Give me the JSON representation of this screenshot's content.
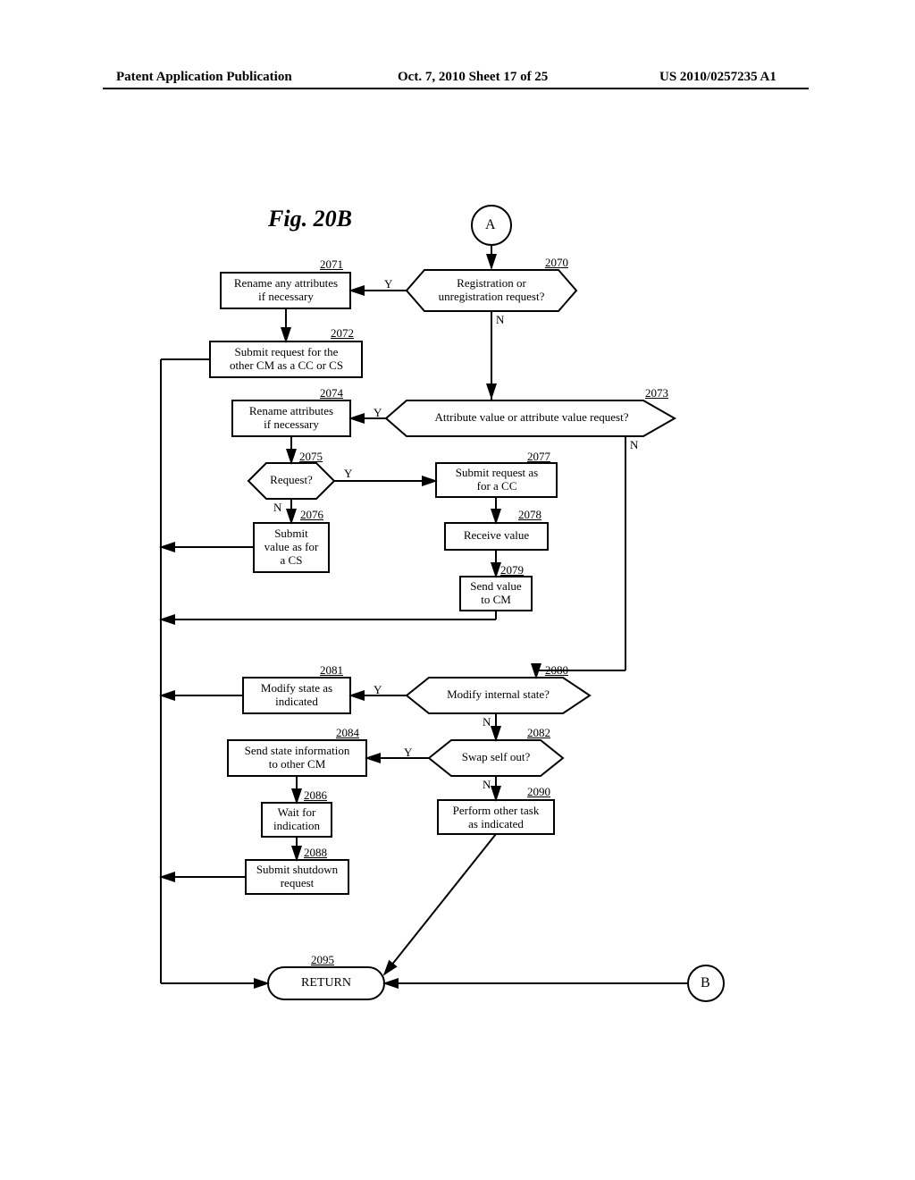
{
  "header": {
    "left": "Patent Application Publication",
    "center": "Oct. 7, 2010  Sheet 17 of 25",
    "right": "US 2010/0257235 A1"
  },
  "figure_title": "Fig. 20B",
  "connectors": {
    "A": "A",
    "B": "B"
  },
  "nodes": {
    "n2070": {
      "num": "2070",
      "text": "Registration or\nunregistration request?"
    },
    "n2071": {
      "num": "2071",
      "text": "Rename any attributes\nif necessary"
    },
    "n2072": {
      "num": "2072",
      "text": "Submit request for the\nother CM as a CC or CS"
    },
    "n2073": {
      "num": "2073",
      "text": "Attribute value or attribute value request?"
    },
    "n2074": {
      "num": "2074",
      "text": "Rename attributes\nif necessary"
    },
    "n2075": {
      "num": "2075",
      "text": "Request?"
    },
    "n2076": {
      "num": "2076",
      "text": "Submit\nvalue as for\na CS"
    },
    "n2077": {
      "num": "2077",
      "text": "Submit request as\nfor a CC"
    },
    "n2078": {
      "num": "2078",
      "text": "Receive value"
    },
    "n2079": {
      "num": "2079",
      "text": "Send value\nto CM"
    },
    "n2080": {
      "num": "2080",
      "text": "Modify internal state?"
    },
    "n2081": {
      "num": "2081",
      "text": "Modify state as\nindicated"
    },
    "n2082": {
      "num": "2082",
      "text": "Swap self out?"
    },
    "n2084": {
      "num": "2084",
      "text": "Send state information\nto other CM"
    },
    "n2086": {
      "num": "2086",
      "text": "Wait for\nindication"
    },
    "n2088": {
      "num": "2088",
      "text": "Submit shutdown\nrequest"
    },
    "n2090": {
      "num": "2090",
      "text": "Perform other task\nas indicated"
    },
    "n2095": {
      "num": "2095",
      "text": "RETURN"
    }
  },
  "labels": {
    "Y": "Y",
    "N": "N"
  }
}
